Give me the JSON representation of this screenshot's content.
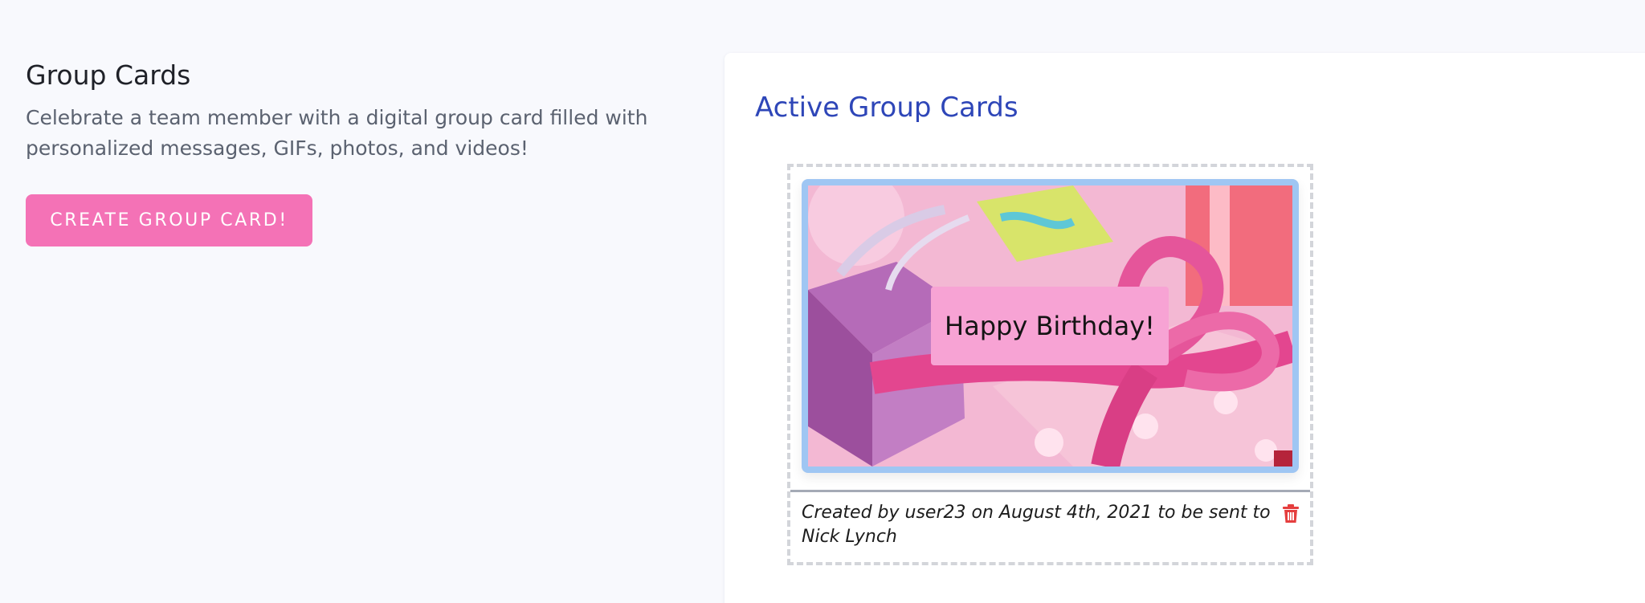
{
  "intro": {
    "title": "Group Cards",
    "description": "Celebrate a team member with a digital group card filled with personalized messages, GIFs, photos, and videos!",
    "create_button": "CREATE GROUP CARD!"
  },
  "panel": {
    "title": "Active Group Cards"
  },
  "cards": [
    {
      "greeting": "Happy Birthday!",
      "caption": "Created by user23 on August 4th, 2021 to be sent to Nick Lynch",
      "delete_icon": "trash-icon"
    }
  ],
  "colors": {
    "background": "#f8f9fd",
    "accent_pink": "#f472b6",
    "title_blue": "#2e46b8",
    "frame_blue": "#9fc6f3",
    "delete_red": "#e53e3e"
  }
}
